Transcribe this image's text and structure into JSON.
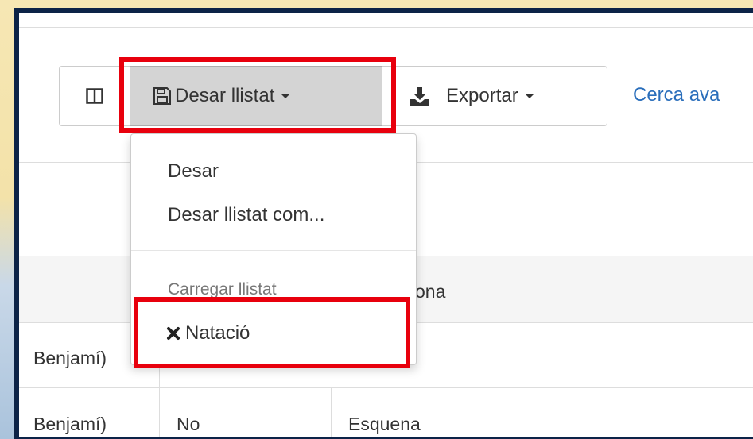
{
  "toolbar": {
    "save_label": "Desar llistat",
    "export_label": "Exportar",
    "advanced_search_label": "Cerca ava"
  },
  "dropdown": {
    "items": [
      {
        "label": "Desar"
      },
      {
        "label": "Desar llistat com..."
      }
    ],
    "header": "Carregar llistat",
    "saved_list": {
      "label": "Natació",
      "delete_icon": "times-icon"
    }
  },
  "table": {
    "header_partial": "ona",
    "rows": [
      {
        "category": "Benjamí)",
        "value": "",
        "style": ""
      },
      {
        "category": "Benjamí)",
        "value": "No",
        "style": "Esquena"
      }
    ]
  },
  "colors": {
    "highlight": "#e8000d",
    "link": "#2a6ebb",
    "frame": "#0c2347"
  }
}
